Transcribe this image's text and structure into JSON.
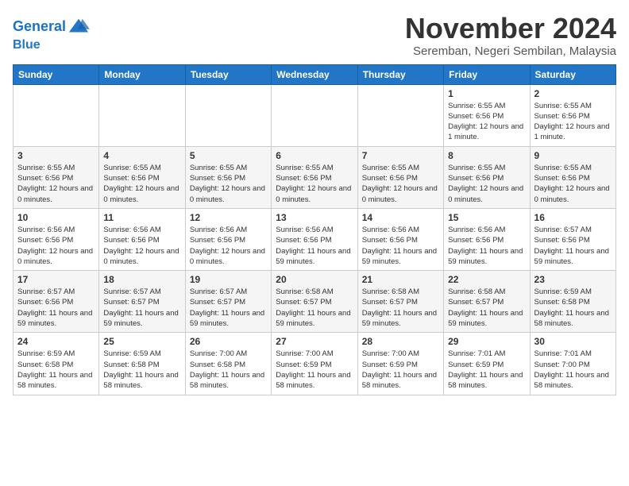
{
  "header": {
    "logo_line1": "General",
    "logo_line2": "Blue",
    "month_title": "November 2024",
    "subtitle": "Seremban, Negeri Sembilan, Malaysia"
  },
  "weekdays": [
    "Sunday",
    "Monday",
    "Tuesday",
    "Wednesday",
    "Thursday",
    "Friday",
    "Saturday"
  ],
  "weeks": [
    [
      {
        "day": "",
        "info": ""
      },
      {
        "day": "",
        "info": ""
      },
      {
        "day": "",
        "info": ""
      },
      {
        "day": "",
        "info": ""
      },
      {
        "day": "",
        "info": ""
      },
      {
        "day": "1",
        "info": "Sunrise: 6:55 AM\nSunset: 6:56 PM\nDaylight: 12 hours and 1 minute."
      },
      {
        "day": "2",
        "info": "Sunrise: 6:55 AM\nSunset: 6:56 PM\nDaylight: 12 hours and 1 minute."
      }
    ],
    [
      {
        "day": "3",
        "info": "Sunrise: 6:55 AM\nSunset: 6:56 PM\nDaylight: 12 hours and 0 minutes."
      },
      {
        "day": "4",
        "info": "Sunrise: 6:55 AM\nSunset: 6:56 PM\nDaylight: 12 hours and 0 minutes."
      },
      {
        "day": "5",
        "info": "Sunrise: 6:55 AM\nSunset: 6:56 PM\nDaylight: 12 hours and 0 minutes."
      },
      {
        "day": "6",
        "info": "Sunrise: 6:55 AM\nSunset: 6:56 PM\nDaylight: 12 hours and 0 minutes."
      },
      {
        "day": "7",
        "info": "Sunrise: 6:55 AM\nSunset: 6:56 PM\nDaylight: 12 hours and 0 minutes."
      },
      {
        "day": "8",
        "info": "Sunrise: 6:55 AM\nSunset: 6:56 PM\nDaylight: 12 hours and 0 minutes."
      },
      {
        "day": "9",
        "info": "Sunrise: 6:55 AM\nSunset: 6:56 PM\nDaylight: 12 hours and 0 minutes."
      }
    ],
    [
      {
        "day": "10",
        "info": "Sunrise: 6:56 AM\nSunset: 6:56 PM\nDaylight: 12 hours and 0 minutes."
      },
      {
        "day": "11",
        "info": "Sunrise: 6:56 AM\nSunset: 6:56 PM\nDaylight: 12 hours and 0 minutes."
      },
      {
        "day": "12",
        "info": "Sunrise: 6:56 AM\nSunset: 6:56 PM\nDaylight: 12 hours and 0 minutes."
      },
      {
        "day": "13",
        "info": "Sunrise: 6:56 AM\nSunset: 6:56 PM\nDaylight: 11 hours and 59 minutes."
      },
      {
        "day": "14",
        "info": "Sunrise: 6:56 AM\nSunset: 6:56 PM\nDaylight: 11 hours and 59 minutes."
      },
      {
        "day": "15",
        "info": "Sunrise: 6:56 AM\nSunset: 6:56 PM\nDaylight: 11 hours and 59 minutes."
      },
      {
        "day": "16",
        "info": "Sunrise: 6:57 AM\nSunset: 6:56 PM\nDaylight: 11 hours and 59 minutes."
      }
    ],
    [
      {
        "day": "17",
        "info": "Sunrise: 6:57 AM\nSunset: 6:56 PM\nDaylight: 11 hours and 59 minutes."
      },
      {
        "day": "18",
        "info": "Sunrise: 6:57 AM\nSunset: 6:57 PM\nDaylight: 11 hours and 59 minutes."
      },
      {
        "day": "19",
        "info": "Sunrise: 6:57 AM\nSunset: 6:57 PM\nDaylight: 11 hours and 59 minutes."
      },
      {
        "day": "20",
        "info": "Sunrise: 6:58 AM\nSunset: 6:57 PM\nDaylight: 11 hours and 59 minutes."
      },
      {
        "day": "21",
        "info": "Sunrise: 6:58 AM\nSunset: 6:57 PM\nDaylight: 11 hours and 59 minutes."
      },
      {
        "day": "22",
        "info": "Sunrise: 6:58 AM\nSunset: 6:57 PM\nDaylight: 11 hours and 59 minutes."
      },
      {
        "day": "23",
        "info": "Sunrise: 6:59 AM\nSunset: 6:58 PM\nDaylight: 11 hours and 58 minutes."
      }
    ],
    [
      {
        "day": "24",
        "info": "Sunrise: 6:59 AM\nSunset: 6:58 PM\nDaylight: 11 hours and 58 minutes."
      },
      {
        "day": "25",
        "info": "Sunrise: 6:59 AM\nSunset: 6:58 PM\nDaylight: 11 hours and 58 minutes."
      },
      {
        "day": "26",
        "info": "Sunrise: 7:00 AM\nSunset: 6:58 PM\nDaylight: 11 hours and 58 minutes."
      },
      {
        "day": "27",
        "info": "Sunrise: 7:00 AM\nSunset: 6:59 PM\nDaylight: 11 hours and 58 minutes."
      },
      {
        "day": "28",
        "info": "Sunrise: 7:00 AM\nSunset: 6:59 PM\nDaylight: 11 hours and 58 minutes."
      },
      {
        "day": "29",
        "info": "Sunrise: 7:01 AM\nSunset: 6:59 PM\nDaylight: 11 hours and 58 minutes."
      },
      {
        "day": "30",
        "info": "Sunrise: 7:01 AM\nSunset: 7:00 PM\nDaylight: 11 hours and 58 minutes."
      }
    ]
  ]
}
